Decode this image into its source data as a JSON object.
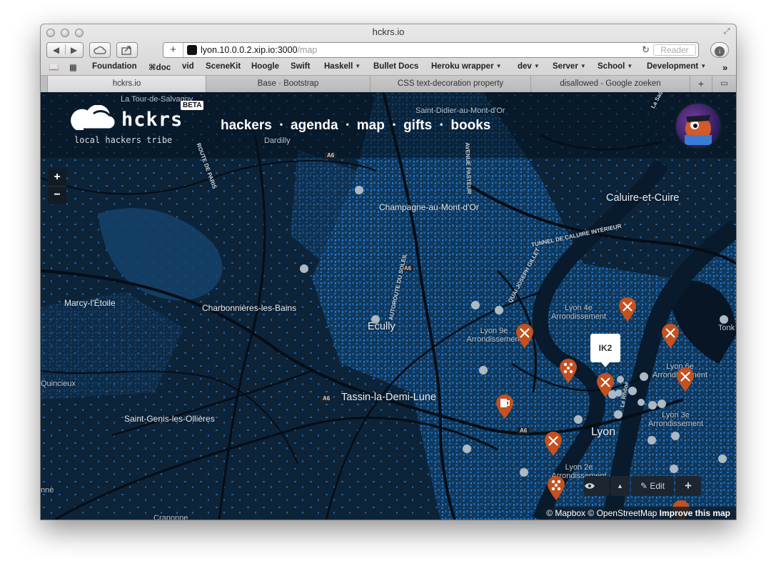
{
  "window": {
    "title": "hckrs.io"
  },
  "toolbar": {
    "back_icon": "back-arrow-icon",
    "forward_icon": "forward-arrow-icon",
    "icloud_icon": "cloud-icon",
    "share_icon": "share-icon",
    "new_tab_label": "+",
    "url_host": "lyon.10.0.0.2.xip.io:3000",
    "url_path": "/map",
    "reader_label": "Reader",
    "downloads_icon": "download-icon"
  },
  "bookmarks": [
    {
      "label": "Foundation",
      "menu": false
    },
    {
      "label": "⌘doc",
      "menu": false
    },
    {
      "label": "vid",
      "menu": false
    },
    {
      "label": "SceneKit",
      "menu": false
    },
    {
      "label": "Hoogle",
      "menu": false
    },
    {
      "label": "Swift",
      "menu": false
    },
    {
      "label": "Haskell",
      "menu": true
    },
    {
      "label": "Bullet Docs",
      "menu": false
    },
    {
      "label": "Heroku wrapper",
      "menu": true
    },
    {
      "label": "dev",
      "menu": true
    },
    {
      "label": "Server",
      "menu": true
    },
    {
      "label": "School",
      "menu": true
    },
    {
      "label": "Development",
      "menu": true
    }
  ],
  "tabs": [
    {
      "label": "hckrs.io",
      "active": true
    },
    {
      "label": "Base · Bootstrap",
      "active": false
    },
    {
      "label": "CSS text-decoration property",
      "active": false
    },
    {
      "label": "disallowed - Google zoeken",
      "active": false
    }
  ],
  "site": {
    "logo_text": "hckrs",
    "tagline": "local hackers tribe",
    "beta_badge": "BETA",
    "nav": [
      "hackers",
      "agenda",
      "map",
      "gifts",
      "books"
    ]
  },
  "map": {
    "zoom_in": "+",
    "zoom_out": "−",
    "popup_label": "IK2",
    "tools": {
      "visibility_icon": "eye-icon",
      "collapse_icon": "caret-up-icon",
      "edit_label": "Edit",
      "add_label": "+"
    },
    "attribution": {
      "mapbox": "© Mapbox",
      "osm": "© OpenStreetMap",
      "improve": "Improve this map"
    },
    "labels": [
      "La Tour-de-Salvagny",
      "Saint-Didier-au-Mont-d'Or",
      "Dardilly",
      "Champagne-au-Mont-d'Or",
      "Caluire-et-Cuire",
      "Marcy-l'Étoile",
      "Charbonnières-les-Bains",
      "Ecully",
      "Lyon 4e Arrondissement",
      "Lyon 9e Arrondissement",
      "Tassin-la-Demi-Lune",
      "Lyon 6e Arrondissement",
      "Lyon 3e Arrondissement",
      "Lyon",
      "Saint-Genis-les-Ollières",
      "Quincieux",
      "Lyon 2e Arrondissement",
      "Craponne",
      "nne",
      "Tonk"
    ],
    "road_labels": [
      "A6",
      "A6",
      "A6",
      "A6",
      "ROUTE DE PARIS",
      "AVENUE PASTEUR",
      "AUTOROUTE DU SOLEIL",
      "TUNNEL DE CALUIRE INTÉRIEUR",
      "QUAI JOSEPH GILLET",
      "Le Rhône",
      "La Saône"
    ],
    "pin_colors": {
      "pin": "#c4511f",
      "pin_dark": "#9e3f15"
    }
  }
}
